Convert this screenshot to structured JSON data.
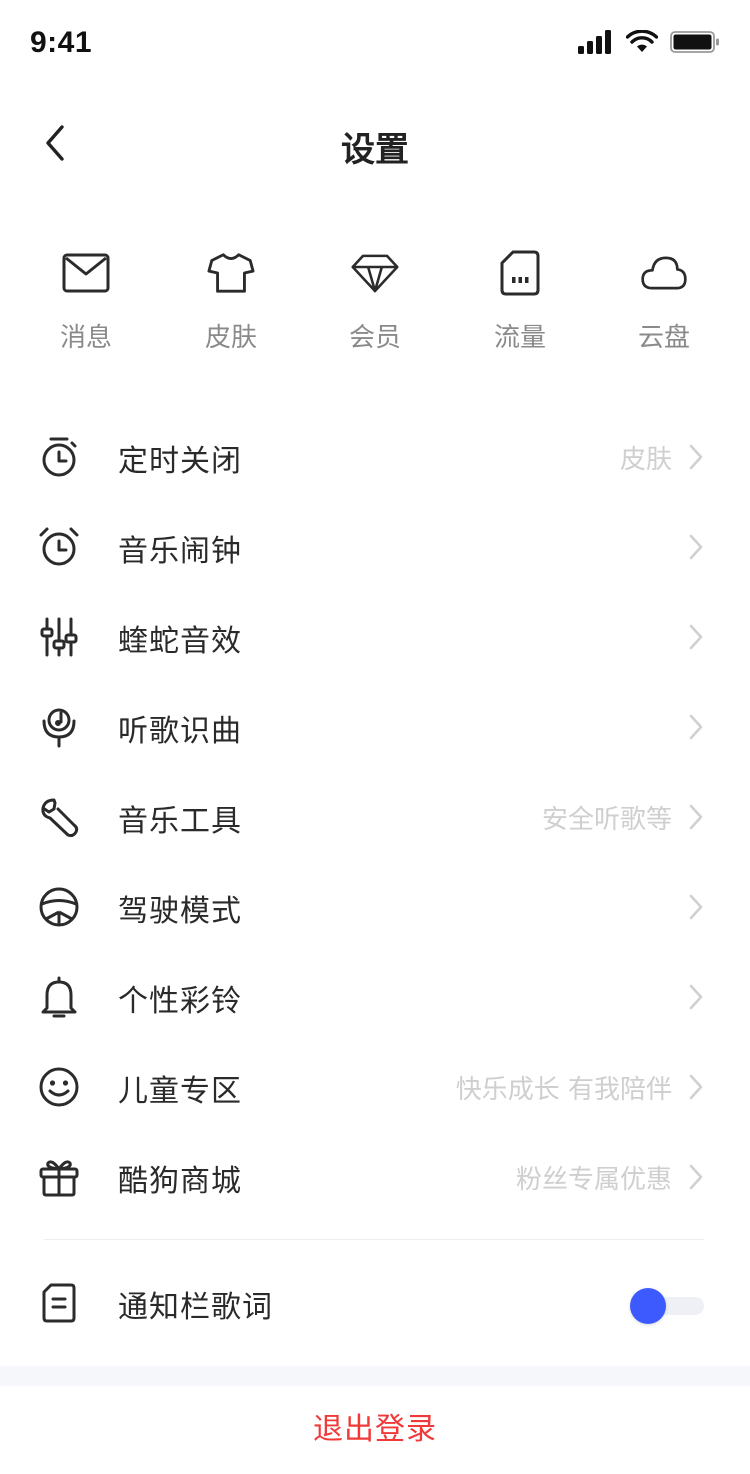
{
  "status_bar": {
    "time": "9:41",
    "icons": [
      "cellular-signal-icon",
      "wifi-icon",
      "battery-icon"
    ]
  },
  "nav": {
    "back_icon": "chevron-left-icon",
    "title": "设置"
  },
  "quick_actions": [
    {
      "icon": "envelope-icon",
      "label": "消息"
    },
    {
      "icon": "tshirt-icon",
      "label": "皮肤"
    },
    {
      "icon": "diamond-icon",
      "label": "会员"
    },
    {
      "icon": "sim-card-icon",
      "label": "流量"
    },
    {
      "icon": "cloud-icon",
      "label": "云盘"
    }
  ],
  "menu": [
    {
      "icon": "timer-icon",
      "label": "定时关闭",
      "hint": "皮肤"
    },
    {
      "icon": "alarm-clock-icon",
      "label": "音乐闹钟",
      "hint": ""
    },
    {
      "icon": "equalizer-icon",
      "label": "蝰蛇音效",
      "hint": ""
    },
    {
      "icon": "microphone-note-icon",
      "label": "听歌识曲",
      "hint": ""
    },
    {
      "icon": "wrench-icon",
      "label": "音乐工具",
      "hint": "安全听歌等"
    },
    {
      "icon": "steering-wheel-icon",
      "label": "驾驶模式",
      "hint": ""
    },
    {
      "icon": "bell-icon",
      "label": "个性彩铃",
      "hint": ""
    },
    {
      "icon": "smiley-face-icon",
      "label": "儿童专区",
      "hint": "快乐成长 有我陪伴"
    },
    {
      "icon": "gift-box-icon",
      "label": "酷狗商城",
      "hint": "粉丝专属优惠"
    }
  ],
  "notification_lyrics": {
    "icon": "document-icon",
    "label": "通知栏歌词",
    "toggle_on": true
  },
  "logout": {
    "label": "退出登录"
  },
  "colors": {
    "accent": "#3d5afe",
    "logout": "#f03a3a",
    "icon_stroke": "#2b2b2b",
    "hint": "#cfcfcf"
  }
}
